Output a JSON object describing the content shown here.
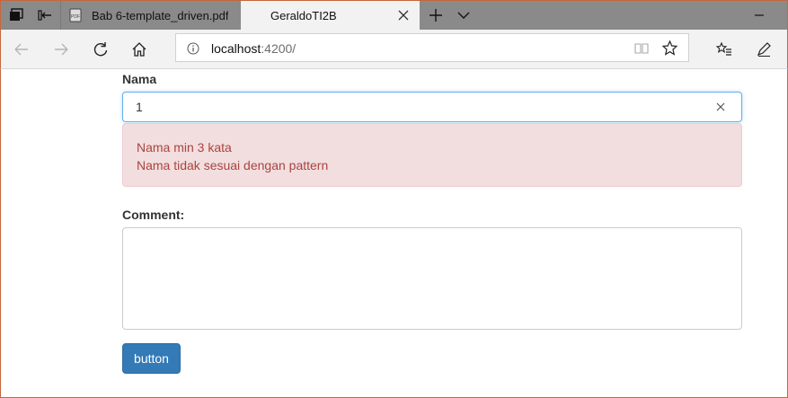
{
  "browser": {
    "tabs": [
      {
        "title": "Bab 6-template_driven.pdf",
        "active": false,
        "icon": "pdf-icon"
      },
      {
        "title": "GeraldoTI2B",
        "active": true
      }
    ],
    "address": {
      "host": "localhost",
      "port_path": ":4200/"
    }
  },
  "form": {
    "nama_label": "Nama",
    "nama_value": "1",
    "errors": [
      "Nama min 3 kata",
      "Nama tidak sesuai dengan pattern"
    ],
    "comment_label": "Comment:",
    "comment_value": "",
    "submit_label": "button"
  },
  "colors": {
    "accent": "#337ab7",
    "error_bg": "#f2dede",
    "error_text": "#a94442",
    "focus_border": "#66afe9",
    "chrome": "#8a8a8a"
  }
}
